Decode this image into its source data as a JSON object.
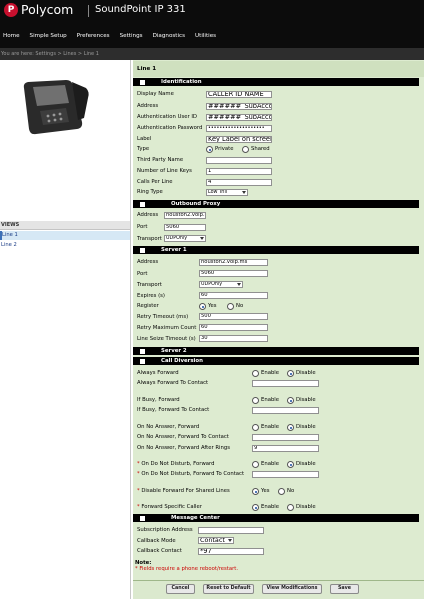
{
  "header": {
    "brand": "Polycom",
    "brand_symbol": "P",
    "model": "SoundPoint IP 331"
  },
  "nav": [
    "Home",
    "Simple Setup",
    "Preferences",
    "Settings",
    "Diagnostics",
    "Utilities"
  ],
  "breadcrumb": "You are here:  Settings > Lines > Line 1",
  "sidebar": {
    "phone_icon": "desk-phone-icon",
    "views_label": "VIEWS",
    "items": [
      "Line 1",
      "Line 2"
    ]
  },
  "page_title": "Line 1",
  "identification": {
    "title": "Identification",
    "display_name": {
      "label": "Display Name",
      "value": "CALLER ID NAME"
    },
    "address": {
      "label": "Address",
      "value": "######_SubAccount"
    },
    "auth_user_id": {
      "label": "Authentication User ID",
      "value": "######_SubAccount"
    },
    "auth_password": {
      "label": "Authentication Password",
      "value": "••••••••••••••••••••"
    },
    "label": {
      "label": "Label",
      "value": "Key Label on screen"
    },
    "type": {
      "label": "Type",
      "options": [
        "Private",
        "Shared"
      ],
      "selected": "Private"
    },
    "third_party_name": {
      "label": "Third Party Name",
      "value": ""
    },
    "num_line_keys": {
      "label": "Number of Line Keys",
      "value": "1"
    },
    "calls_per_line": {
      "label": "Calls Per Line",
      "value": "4"
    },
    "ring_type": {
      "label": "Ring Type",
      "value": "Low Trill"
    }
  },
  "outbound_proxy": {
    "title": "Outbound Proxy",
    "address": {
      "label": "Address",
      "value": "houston2.voip.ms"
    },
    "port": {
      "label": "Port",
      "value": "5060"
    },
    "transport": {
      "label": "Transport",
      "value": "UDPOnly"
    }
  },
  "server1": {
    "title": "Server 1",
    "address": {
      "label": "Address",
      "value": "houston2.voip.ms"
    },
    "port": {
      "label": "Port",
      "value": "5060"
    },
    "transport": {
      "label": "Transport",
      "value": "UDPOnly"
    },
    "expires": {
      "label": "Expires (s)",
      "value": "60"
    },
    "register": {
      "label": "Register",
      "options": [
        "Yes",
        "No"
      ],
      "selected": "Yes"
    },
    "retry_timeout": {
      "label": "Retry Timeout (ms)",
      "value": "500"
    },
    "retry_max": {
      "label": "Retry Maximum Count",
      "value": "60"
    },
    "line_seize": {
      "label": "Line Seize Timeout (s)",
      "value": "30"
    }
  },
  "server2": {
    "title": "Server 2"
  },
  "call_diversion": {
    "title": "Call Diversion",
    "always_forward": {
      "label": "Always Forward",
      "options": [
        "Enable",
        "Disable"
      ],
      "selected": "Disable"
    },
    "always_forward_contact": {
      "label": "Always Forward To Contact",
      "value": ""
    },
    "if_busy": {
      "label": "If Busy, Forward",
      "options": [
        "Enable",
        "Disable"
      ],
      "selected": "Disable"
    },
    "if_busy_contact": {
      "label": "If Busy, Forward To Contact",
      "value": ""
    },
    "no_answer": {
      "label": "On No Answer, Forward",
      "options": [
        "Enable",
        "Disable"
      ],
      "selected": "Disable"
    },
    "no_answer_contact": {
      "label": "On No Answer, Forward To Contact",
      "value": ""
    },
    "no_answer_rings": {
      "label": "On No Answer, Forward After Rings",
      "value": "9"
    },
    "dnd_forward": {
      "label": "On Do Not Disturb, Forward",
      "options": [
        "Enable",
        "Disable"
      ],
      "selected": "Disable"
    },
    "dnd_contact": {
      "label": "On Do Not Disturb, Forward To Contact",
      "value": ""
    },
    "disable_shared": {
      "label": "Disable Forward For Shared Lines",
      "options": [
        "Yes",
        "No"
      ],
      "selected": "Yes"
    },
    "forward_specific": {
      "label": "Forward Specific Caller",
      "options": [
        "Enable",
        "Disable"
      ],
      "selected": "Enable"
    }
  },
  "message_center": {
    "title": "Message Center",
    "subscription": {
      "label": "Subscription Address",
      "value": ""
    },
    "callback_mode": {
      "label": "Callback Mode",
      "value": "Contact"
    },
    "callback_contact": {
      "label": "Callback Contact",
      "value": "*97"
    }
  },
  "note": {
    "title": "Note:",
    "text": "* Fields require a phone reboot/restart."
  },
  "buttons": [
    "Cancel",
    "Reset to Default",
    "View Modifications",
    "Save"
  ],
  "colors": {
    "header_bg": "#0c0c0c",
    "brand_red": "#c8102e",
    "form_bg": "#ddebd0",
    "section_bg": "#000000",
    "required_red": "#cc0000",
    "link_blue": "#1a3c86"
  }
}
